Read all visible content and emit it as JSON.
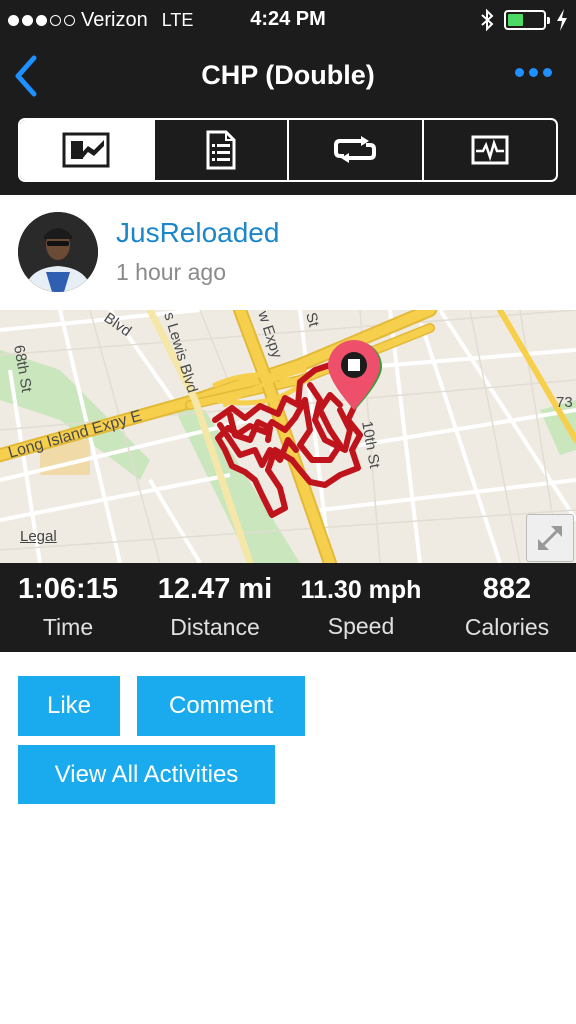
{
  "status_bar": {
    "carrier": "Verizon",
    "network": "LTE",
    "time": "4:24 PM",
    "signal_bars_filled": 3,
    "signal_bars_total": 5,
    "battery_level": 0.45
  },
  "nav": {
    "title": "CHP (Double)",
    "back_icon": "chevron-left-icon",
    "more_icon": "ellipsis-icon",
    "accent_color": "#1e90ff"
  },
  "tabs": [
    {
      "icon": "map-icon",
      "active": true
    },
    {
      "icon": "details-list-icon",
      "active": false
    },
    {
      "icon": "laps-loop-icon",
      "active": false
    },
    {
      "icon": "chart-icon",
      "active": false
    }
  ],
  "activity": {
    "username": "JusReloaded",
    "time_ago": "1 hour ago"
  },
  "map": {
    "labels": {
      "long_island_expy": "Long Island Expy E",
      "lewis_blvd": "s Lewis Blvd",
      "blvd": "Blvd",
      "expy": "w Expy",
      "st_top": "St",
      "tenth_st": "10th St",
      "eighth_st": "68th St",
      "num_73": "73"
    },
    "legal": "Legal",
    "route_color": "#c0141c",
    "pin_color": "#ee4f6b"
  },
  "stats": [
    {
      "value": "1:06:15",
      "label": "Time"
    },
    {
      "value": "12.47 mi",
      "label": "Distance"
    },
    {
      "value": "11.30 mph",
      "label": "Speed"
    },
    {
      "value": "882",
      "label": "Calories"
    }
  ],
  "actions": {
    "like": "Like",
    "comment": "Comment",
    "view_all": "View All Activities",
    "button_color": "#1aabef"
  }
}
